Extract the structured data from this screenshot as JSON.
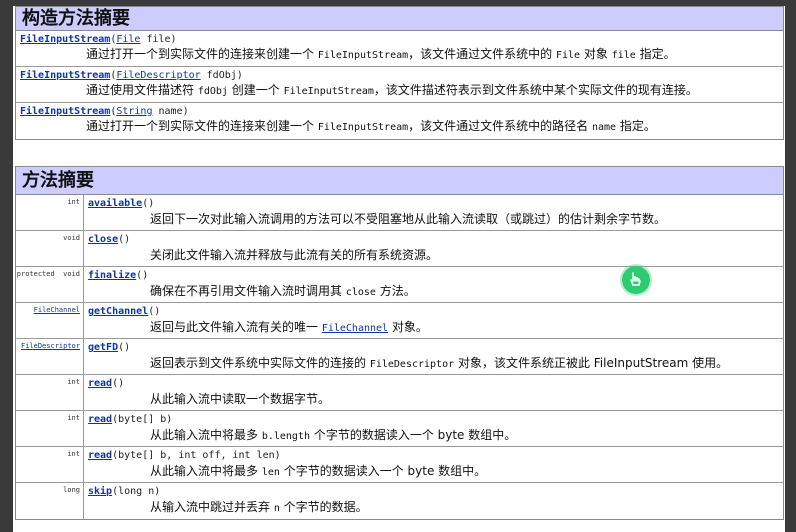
{
  "constructor_summary": {
    "title": "构造方法摘要",
    "rows": [
      {
        "name": "FileInputStream",
        "open": "(",
        "param_type": "File",
        "param_rest": " file)",
        "desc_before": "通过打开一个到实际文件的连接来创建一个 ",
        "desc_code1": "FileInputStream",
        "desc_middle": "，该文件通过文件系统中的 ",
        "desc_code2": "File",
        "desc_middle2": " 对象 ",
        "desc_code3": "file",
        "desc_after": " 指定。"
      },
      {
        "name": "FileInputStream",
        "open": "(",
        "param_type": "FileDescriptor",
        "param_rest": " fdObj)",
        "desc_before": "通过使用文件描述符 ",
        "desc_code1": "fdObj",
        "desc_middle": " 创建一个 ",
        "desc_code2": "FileInputStream",
        "desc_middle2": "，该文件描述符表示到文件系统中某个实际文件的现有连接。",
        "desc_code3": "",
        "desc_after": ""
      },
      {
        "name": "FileInputStream",
        "open": "(",
        "param_type": "String",
        "param_rest": " name)",
        "desc_before": "通过打开一个到实际文件的连接来创建一个 ",
        "desc_code1": "FileInputStream",
        "desc_middle": "，该文件通过文件系统中的路径名 ",
        "desc_code2": "name",
        "desc_middle2": " 指定。",
        "desc_code3": "",
        "desc_after": ""
      }
    ]
  },
  "method_summary": {
    "title": "方法摘要",
    "rows": [
      {
        "modifier": "",
        "type": "int",
        "type_is_link": false,
        "name": "available",
        "params": "()",
        "desc": "返回下一次对此输入流调用的方法可以不受阻塞地从此输入流读取（或跳过）的估计剩余字节数。",
        "desc_code": "",
        "desc_after": ""
      },
      {
        "modifier": "",
        "type": "void",
        "type_is_link": false,
        "name": "close",
        "params": "()",
        "desc": "关闭此文件输入流并释放与此流有关的所有系统资源。",
        "desc_code": "",
        "desc_after": ""
      },
      {
        "modifier": "protected",
        "type": "void",
        "type_is_link": false,
        "name": "finalize",
        "params": "()",
        "desc": "确保在不再引用文件输入流时调用其 ",
        "desc_code": "close",
        "desc_after": " 方法。"
      },
      {
        "modifier": "",
        "type": "FileChannel",
        "type_is_link": true,
        "name": "getChannel",
        "params": "()",
        "desc": "返回与此文件输入流有关的唯一 ",
        "desc_code": "FileChannel",
        "desc_after": " 对象。"
      },
      {
        "modifier": "",
        "type": "FileDescriptor",
        "type_is_link": true,
        "name": "getFD",
        "params": "()",
        "desc": "返回表示到文件系统中实际文件的连接的 ",
        "desc_code": "FileDescriptor",
        "desc_after": " 对象，该文件系统正被此 FileInputStream 使用。"
      },
      {
        "modifier": "",
        "type": "int",
        "type_is_link": false,
        "name": "read",
        "params": "()",
        "desc": "从此输入流中读取一个数据字节。",
        "desc_code": "",
        "desc_after": ""
      },
      {
        "modifier": "",
        "type": "int",
        "type_is_link": false,
        "name": "read",
        "params": "(byte[] b)",
        "desc": "从此输入流中将最多 ",
        "desc_code": "b.length",
        "desc_after": " 个字节的数据读入一个 byte 数组中。"
      },
      {
        "modifier": "",
        "type": "int",
        "type_is_link": false,
        "name": "read",
        "params": "(byte[] b, int off, int len)",
        "desc": "从此输入流中将最多 ",
        "desc_code": "len",
        "desc_after": " 个字节的数据读入一个 byte 数组中。"
      },
      {
        "modifier": "",
        "type": "long",
        "type_is_link": false,
        "name": "skip",
        "params": "(long n)",
        "desc": "从输入流中跳过并丢弃 ",
        "desc_code": "n",
        "desc_after": " 个字节的数据。"
      }
    ]
  },
  "cursor": {
    "icon": "hand-pointer-icon",
    "color": "#2ecc71"
  }
}
